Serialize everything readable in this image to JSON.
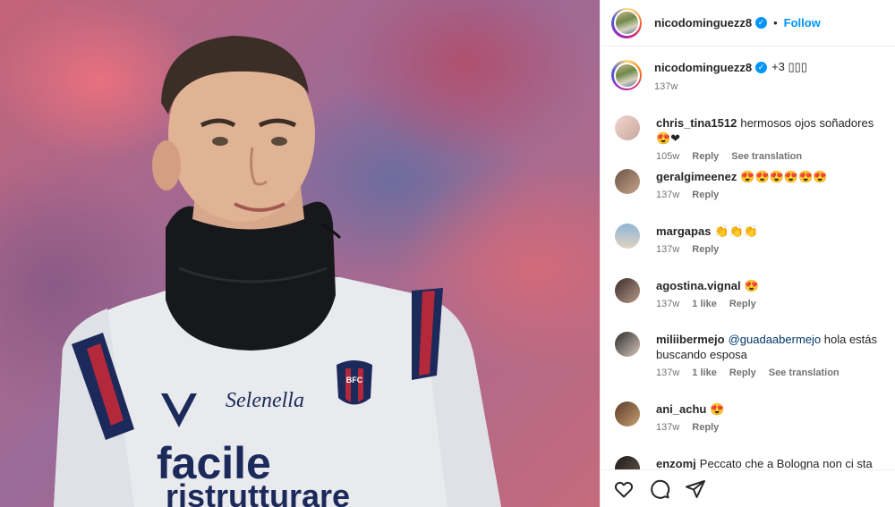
{
  "post": {
    "username": "nicodominguezz8",
    "follow_label": "Follow",
    "separator": "•",
    "caption_text": "+3 ▯▯▯",
    "caption_time": "137w",
    "reply_label": "Reply",
    "translate_label": "See translation"
  },
  "comments": [
    {
      "username": "chris_tina1512",
      "text": "hermosos ojos soñadores 😍❤",
      "time": "105w",
      "likes": "",
      "translation": "See translation"
    },
    {
      "username": "geralgimeenez",
      "text": "😍😍😍😍😍😍",
      "time": "137w",
      "likes": "",
      "translation": ""
    },
    {
      "username": "margapas",
      "text": "👏👏👏",
      "time": "137w",
      "likes": "",
      "translation": ""
    },
    {
      "username": "agostina.vignal",
      "text": "😍",
      "time": "137w",
      "likes": "1 like",
      "translation": ""
    },
    {
      "username": "miliibermejo",
      "mention": "@guadaabermejo",
      "text": "hola estás buscando esposa",
      "time": "137w",
      "likes": "1 like",
      "translation": "See translation"
    },
    {
      "username": "ani_achu",
      "text": "😍",
      "time": "137w",
      "likes": "",
      "translation": ""
    },
    {
      "username": "enzomj",
      "text": "Peccato che a Bologna non ci sta dire",
      "time": "",
      "likes": "",
      "translation": ""
    }
  ],
  "jersey": {
    "sponsor": "Selenella",
    "front_line1": "facile",
    "front_line2": "ristrutturare",
    "crest": "BFC"
  },
  "icons": {
    "like": "heart-icon",
    "comment": "comment-icon",
    "share": "share-icon"
  },
  "colors": {
    "accent": "#0095f6",
    "text": "#262626",
    "muted": "#737373"
  }
}
